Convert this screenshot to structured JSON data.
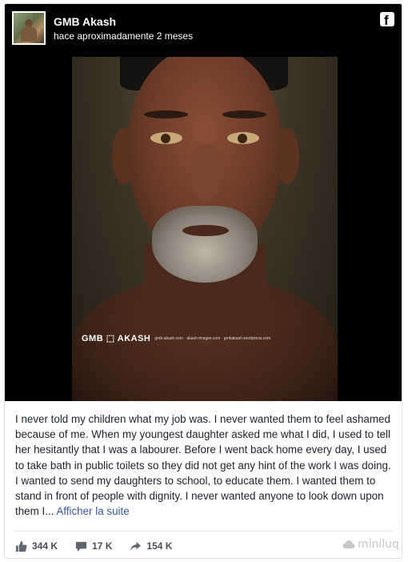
{
  "post": {
    "author": "GMB Akash",
    "time": "hace aproximadamente 2 meses",
    "platform_icon": "facebook-icon",
    "photo_watermark": {
      "brand": "GMB ⬚ AKASH",
      "sub": "gmb-akash.com · akash-images.com · gmbakash.wordpress.com"
    },
    "caption": "I never told my children what my job was. I never wanted them to feel ashamed because of me. When my youngest daughter asked me what I did, I used to tell her hesitantly that I was a labourer. Before I went back home every day, I used to take bath in public toilets so they did not get any hint of the work I was doing. I wanted to send my daughters to school, to educate them. I wanted them to stand in front of people with dignity. I never wanted anyone to look down upon them I...",
    "see_more": "Afficher la suite"
  },
  "stats": {
    "likes": "344 K",
    "comments": "17 K",
    "shares": "154 K"
  },
  "branding": {
    "site_watermark": "miniluq"
  },
  "colors": {
    "link": "#365899",
    "text": "#1d2129",
    "header_bg": "#000000"
  }
}
